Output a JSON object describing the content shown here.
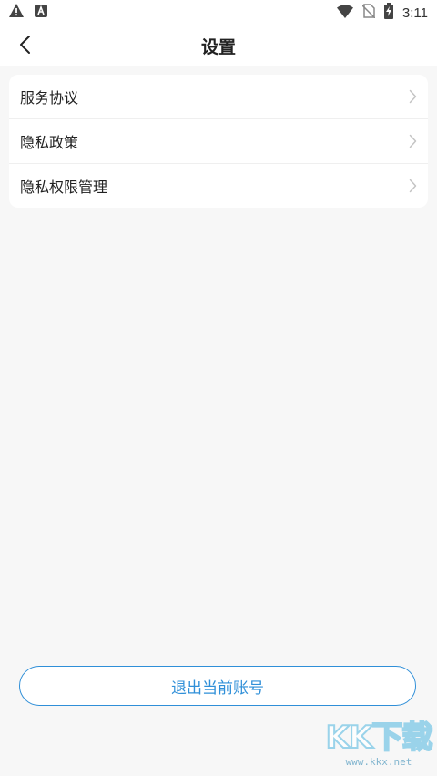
{
  "status_bar": {
    "time": "3:11",
    "left_icons": [
      "warning-icon",
      "a-app-icon"
    ],
    "right_icons": [
      "wifi-icon",
      "no-sim-icon",
      "battery-charging-icon"
    ]
  },
  "header": {
    "title": "设置",
    "back_icon": "chevron-left-icon"
  },
  "settings": {
    "items": [
      {
        "label": "服务协议"
      },
      {
        "label": "隐私政策"
      },
      {
        "label": "隐私权限管理"
      }
    ]
  },
  "logout": {
    "label": "退出当前账号"
  },
  "watermark": {
    "logo_text": "KK下载",
    "url": "www.kkx.net"
  },
  "colors": {
    "accent": "#2f8fd8",
    "background": "#f7f7f7",
    "card": "#ffffff",
    "chevron": "#c4c4c4"
  }
}
